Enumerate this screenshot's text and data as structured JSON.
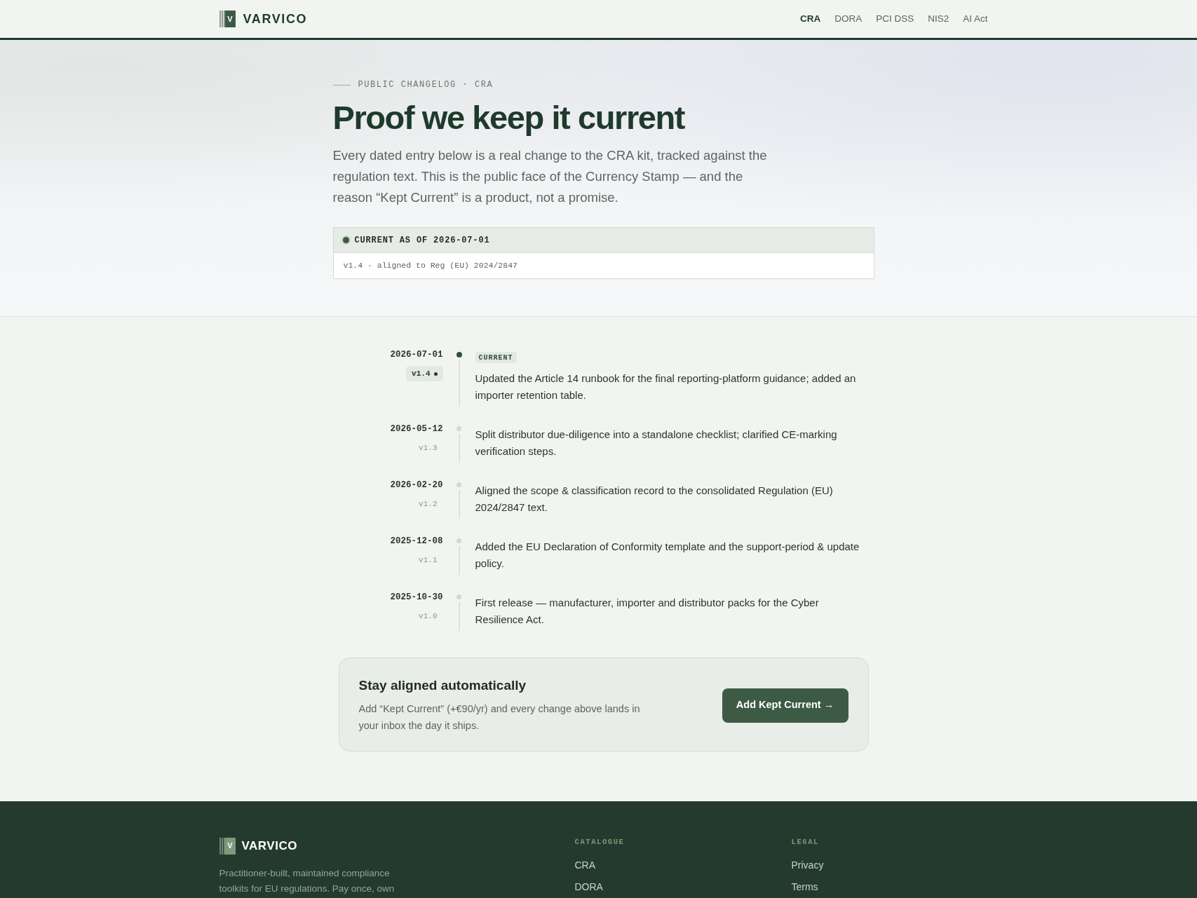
{
  "header": {
    "logo": {
      "mark": "V",
      "name": "VARVICO"
    },
    "nav": [
      {
        "label": "CRA",
        "selected": true
      },
      {
        "label": "DORA",
        "selected": false
      },
      {
        "label": "PCI DSS",
        "selected": false
      },
      {
        "label": "NIS2",
        "selected": false
      },
      {
        "label": "AI Act",
        "selected": false
      }
    ]
  },
  "hero": {
    "eyebrow": "PUBLIC CHANGELOG · CRA",
    "title": "Proof we keep it current",
    "intro": "Every dated entry below is a real change to the CRA kit, tracked against the regulation text. This is the public face of the Currency Stamp — and the reason “Kept Current” is a product, not a promise.",
    "status": {
      "label": "CURRENT AS OF 2026-07-01",
      "detail": "v1.4 · aligned to Reg (EU) 2024/2847"
    }
  },
  "changelog": [
    {
      "date": "2026-07-01",
      "version": "v1.4",
      "current": true,
      "badge": "CURRENT",
      "text": "Updated the Article 14 runbook for the final reporting-platform guidance; added an importer retention table."
    },
    {
      "date": "2026-05-12",
      "version": "v1.3",
      "current": false,
      "text": "Split distributor due-diligence into a standalone checklist; clarified CE-marking verification steps."
    },
    {
      "date": "2026-02-20",
      "version": "v1.2",
      "current": false,
      "text": "Aligned the scope & classification record to the consolidated Regulation (EU) 2024/2847 text."
    },
    {
      "date": "2025-12-08",
      "version": "v1.1",
      "current": false,
      "text": "Added the EU Declaration of Conformity template and the support-period & update policy."
    },
    {
      "date": "2025-10-30",
      "version": "v1.0",
      "current": false,
      "text": "First release — manufacturer, importer and distributor packs for the Cyber Resilience Act."
    }
  ],
  "cta": {
    "title": "Stay aligned automatically",
    "text": "Add “Kept Current” (+€90/yr) and every change above lands in your inbox the day it ships.",
    "button": "Add Kept Current →"
  },
  "footer": {
    "logo": {
      "mark": "V",
      "name": "VARVICO"
    },
    "tagline": "Practitioner-built, maintained compliance toolkits for EU regulations. Pay once, own",
    "columns": [
      {
        "heading": "CATALOGUE",
        "links": [
          "CRA",
          "DORA"
        ]
      },
      {
        "heading": "LEGAL",
        "links": [
          "Privacy",
          "Terms"
        ]
      }
    ]
  }
}
